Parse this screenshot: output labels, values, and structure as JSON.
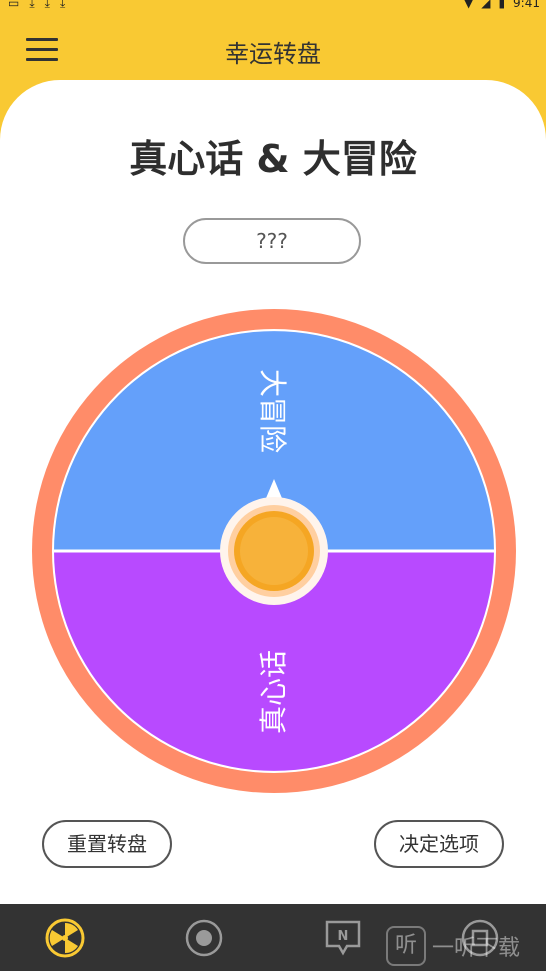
{
  "status_bar": {
    "time": "9:41"
  },
  "app_bar": {
    "title": "幸运转盘"
  },
  "main": {
    "title": "真心话 & 大冒险",
    "result": "???"
  },
  "wheel": {
    "segments": [
      {
        "label": "大冒险",
        "color": "#64A0FA"
      },
      {
        "label": "真心话",
        "color": "#B84AFF"
      }
    ],
    "ring_color": "#FF8C69",
    "center_color": "#F5A623"
  },
  "buttons": {
    "reset_label": "重置转盘",
    "decide_label": "决定选项"
  },
  "bottom_nav": {
    "items": [
      {
        "icon": "wheel-icon",
        "active": true
      },
      {
        "icon": "record-icon",
        "active": false
      },
      {
        "icon": "note-icon",
        "active": false
      },
      {
        "icon": "settings-icon",
        "active": false
      }
    ]
  },
  "watermark": {
    "text": "一听下载",
    "logo_glyph": "听"
  },
  "colors": {
    "primary": "#F9C933",
    "nav_bg": "#333333",
    "active_icon": "#F9C933",
    "inactive_icon": "#9A9A9A"
  }
}
